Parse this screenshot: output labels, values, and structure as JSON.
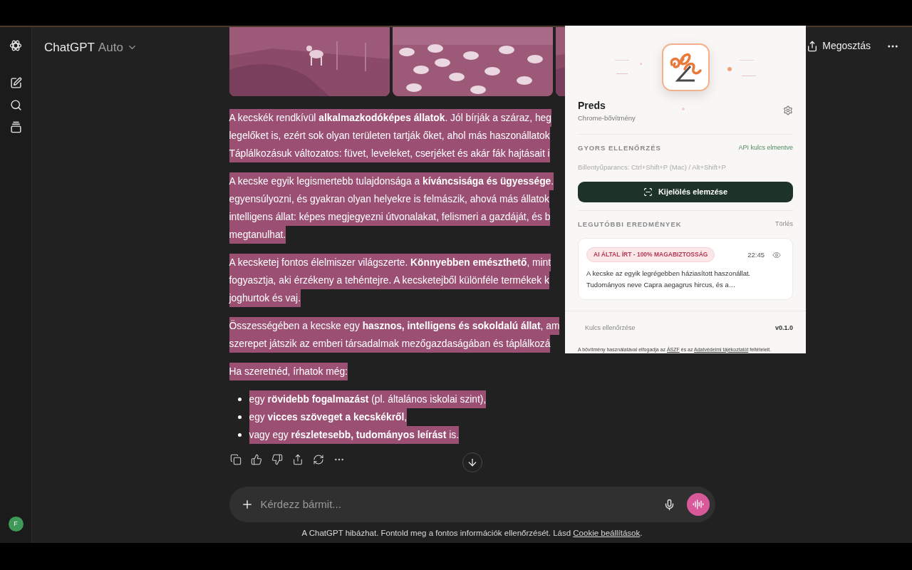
{
  "header": {
    "title": "ChatGPT",
    "model": "Auto",
    "share": "Megosztás"
  },
  "sidebar": {
    "avatar": "F"
  },
  "message": {
    "selected": true,
    "blocks": [
      {
        "kind": "paragraph",
        "lines": [
          "A kecskék rendkívül **alkalmazkodóképes állatok**. Jól bírják a száraz, heg",
          "legelőket is, ezért sok olyan területen tartják őket, ahol más haszonállatok",
          "Táplálkozásuk változatos: füvet, leveleket, cserjéket és akár fák hajtásait i"
        ]
      },
      {
        "kind": "paragraph",
        "lines": [
          "A kecske egyik legismertebb tulajdonsága a **kíváncsisága és ügyessége**.",
          "egyensúlyozni, és gyakran olyan helyekre is felmászik, ahová más állatok",
          "intelligens állat: képes megjegyezni útvonalakat, felismeri a gazdáját, és b",
          "megtanulhat."
        ]
      },
      {
        "kind": "paragraph",
        "lines": [
          "A kecsketej fontos élelmiszer világszerte. **Könnyebben emészthető**, mint",
          "fogyasztja, aki érzékeny a tehéntejre. A kecsketejből különféle termékek k",
          "joghurtok és vaj."
        ]
      },
      {
        "kind": "paragraph",
        "lines": [
          "Összességében a kecske egy **hasznos, intelligens és sokoldalú állat**, am",
          "szerepet játszik az emberi társadalmak mezőgazdaságában és táplálkozá"
        ]
      },
      {
        "kind": "paragraph",
        "lines": [
          "Ha szeretnéd, írhatok még:"
        ]
      },
      {
        "kind": "list",
        "lines": [
          "egy **rövidebb fogalmazást** (pl. általános iskolai szint),",
          "egy **vicces szöveget a kecskékről**,",
          "vagy egy **részletesebb, tudományos leírást** is."
        ]
      }
    ]
  },
  "composer": {
    "placeholder": "Kérdezz bármit..."
  },
  "disclaimer": {
    "text": "A ChatGPT hibázhat. Fontold meg a fontos információk ellenőrzését. Lásd",
    "link": "Cookie beállítások",
    "end": "."
  },
  "extension": {
    "name": "Preds",
    "subtitle": "Chrome-bővítmény",
    "quick_check": {
      "heading": "GYORS ELLENŐRZÉS",
      "status": "API kulcs elmentve",
      "shortcut": "Billentyűparancs: Ctrl+Shift+P (Mac) / Alt+Shift+P",
      "button": "Kijelölés elemzése"
    },
    "recent": {
      "heading": "LEGUTÓBBI EREDMÉNYEK",
      "clear": "Törlés",
      "results": [
        {
          "badge": "AI ÁLTAL ÍRT - 100% MAGABIZTOSSÁG",
          "time": "22:45",
          "text": "A kecske az egyik legrégebben háziasított haszonállat. Tudományos neve Capra aegagrus hircus, és a…"
        }
      ]
    },
    "footer": {
      "verify": "Kulcs ellenőrzése",
      "version": "v0.1.0",
      "terms_before": "A bővítmény használatával elfogadja az",
      "terms_link1": "ÁSZF",
      "terms_middle": "és az",
      "terms_link2": "Adatvédelmi tájékoztatót",
      "terms_after": "feltételeit."
    }
  }
}
